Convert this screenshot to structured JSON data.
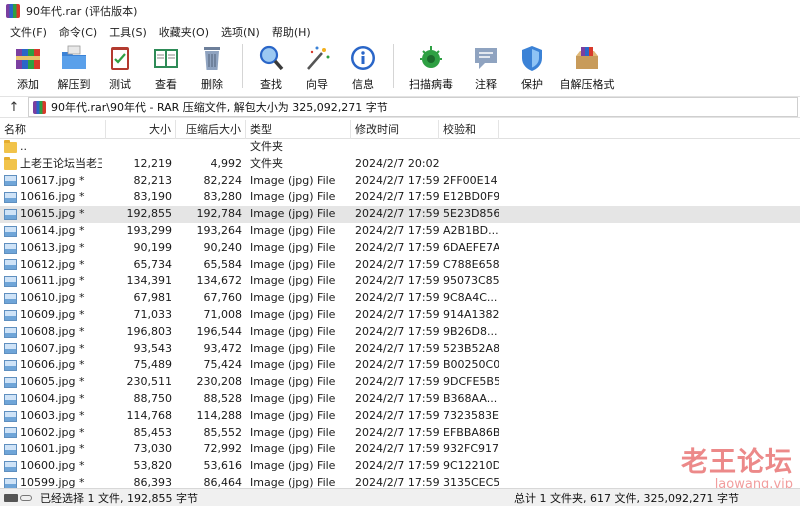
{
  "window": {
    "title": "90年代.rar (评估版本)"
  },
  "menu": [
    "文件(F)",
    "命令(C)",
    "工具(S)",
    "收藏夹(O)",
    "选项(N)",
    "帮助(H)"
  ],
  "toolbar": [
    {
      "label": "添加",
      "icon": "add-books-icon"
    },
    {
      "label": "解压到",
      "icon": "extract-folder-icon"
    },
    {
      "label": "测试",
      "icon": "test-clipboard-icon"
    },
    {
      "label": "查看",
      "icon": "view-book-icon"
    },
    {
      "label": "删除",
      "icon": "trash-icon"
    },
    {
      "label": "查找",
      "icon": "magnifier-icon"
    },
    {
      "label": "向导",
      "icon": "wizard-wand-icon"
    },
    {
      "label": "信息",
      "icon": "info-icon"
    },
    {
      "label": "扫描病毒",
      "icon": "virus-scan-icon"
    },
    {
      "label": "注释",
      "icon": "comment-icon"
    },
    {
      "label": "保护",
      "icon": "shield-icon"
    },
    {
      "label": "自解压格式",
      "icon": "sfx-box-icon"
    }
  ],
  "address": {
    "path": "90年代.rar\\90年代 - RAR 压缩文件, 解包大小为 325,092,271 字节"
  },
  "columns": {
    "name": "名称",
    "size": "大小",
    "packed": "压缩后大小",
    "type": "类型",
    "modified": "修改时间",
    "crc": "校验和"
  },
  "files": [
    {
      "name": "..",
      "size": "",
      "packed": "",
      "type": "文件夹",
      "modified": "",
      "crc": "",
      "kind": "folder"
    },
    {
      "name": "上老王论坛当老王",
      "size": "12,219",
      "packed": "4,992",
      "type": "文件夹",
      "modified": "2024/2/7 20:02",
      "crc": "",
      "kind": "folder"
    },
    {
      "name": "10617.jpg *",
      "size": "82,213",
      "packed": "82,224",
      "type": "Image (jpg) File",
      "modified": "2024/2/7 17:59",
      "crc": "2FF00E14",
      "kind": "image"
    },
    {
      "name": "10616.jpg *",
      "size": "83,190",
      "packed": "83,280",
      "type": "Image (jpg) File",
      "modified": "2024/2/7 17:59",
      "crc": "E12BD0F9",
      "kind": "image"
    },
    {
      "name": "10615.jpg *",
      "size": "192,855",
      "packed": "192,784",
      "type": "Image (jpg) File",
      "modified": "2024/2/7 17:59",
      "crc": "5E23D856",
      "kind": "image",
      "selected": true
    },
    {
      "name": "10614.jpg *",
      "size": "193,299",
      "packed": "193,264",
      "type": "Image (jpg) File",
      "modified": "2024/2/7 17:59",
      "crc": "A2B1BD...",
      "kind": "image"
    },
    {
      "name": "10613.jpg *",
      "size": "90,199",
      "packed": "90,240",
      "type": "Image (jpg) File",
      "modified": "2024/2/7 17:59",
      "crc": "6DAEFE7A",
      "kind": "image"
    },
    {
      "name": "10612.jpg *",
      "size": "65,734",
      "packed": "65,584",
      "type": "Image (jpg) File",
      "modified": "2024/2/7 17:59",
      "crc": "C788E658",
      "kind": "image"
    },
    {
      "name": "10611.jpg *",
      "size": "134,391",
      "packed": "134,672",
      "type": "Image (jpg) File",
      "modified": "2024/2/7 17:59",
      "crc": "95073C85",
      "kind": "image"
    },
    {
      "name": "10610.jpg *",
      "size": "67,981",
      "packed": "67,760",
      "type": "Image (jpg) File",
      "modified": "2024/2/7 17:59",
      "crc": "9C8A4C...",
      "kind": "image"
    },
    {
      "name": "10609.jpg *",
      "size": "71,033",
      "packed": "71,008",
      "type": "Image (jpg) File",
      "modified": "2024/2/7 17:59",
      "crc": "914A1382",
      "kind": "image"
    },
    {
      "name": "10608.jpg *",
      "size": "196,803",
      "packed": "196,544",
      "type": "Image (jpg) File",
      "modified": "2024/2/7 17:59",
      "crc": "9B26D8...",
      "kind": "image"
    },
    {
      "name": "10607.jpg *",
      "size": "93,543",
      "packed": "93,472",
      "type": "Image (jpg) File",
      "modified": "2024/2/7 17:59",
      "crc": "523B52A8",
      "kind": "image"
    },
    {
      "name": "10606.jpg *",
      "size": "75,489",
      "packed": "75,424",
      "type": "Image (jpg) File",
      "modified": "2024/2/7 17:59",
      "crc": "B00250C0",
      "kind": "image"
    },
    {
      "name": "10605.jpg *",
      "size": "230,511",
      "packed": "230,208",
      "type": "Image (jpg) File",
      "modified": "2024/2/7 17:59",
      "crc": "9DCFE5B5",
      "kind": "image"
    },
    {
      "name": "10604.jpg *",
      "size": "88,750",
      "packed": "88,528",
      "type": "Image (jpg) File",
      "modified": "2024/2/7 17:59",
      "crc": "B368AA...",
      "kind": "image"
    },
    {
      "name": "10603.jpg *",
      "size": "114,768",
      "packed": "114,288",
      "type": "Image (jpg) File",
      "modified": "2024/2/7 17:59",
      "crc": "7323583E",
      "kind": "image"
    },
    {
      "name": "10602.jpg *",
      "size": "85,453",
      "packed": "85,552",
      "type": "Image (jpg) File",
      "modified": "2024/2/7 17:59",
      "crc": "EFBBA86B",
      "kind": "image"
    },
    {
      "name": "10601.jpg *",
      "size": "73,030",
      "packed": "72,992",
      "type": "Image (jpg) File",
      "modified": "2024/2/7 17:59",
      "crc": "932FC917",
      "kind": "image"
    },
    {
      "name": "10600.jpg *",
      "size": "53,820",
      "packed": "53,616",
      "type": "Image (jpg) File",
      "modified": "2024/2/7 17:59",
      "crc": "9C12210D",
      "kind": "image"
    },
    {
      "name": "10599.jpg *",
      "size": "86,393",
      "packed": "86,464",
      "type": "Image (jpg) File",
      "modified": "2024/2/7 17:59",
      "crc": "3135CEC5",
      "kind": "image"
    }
  ],
  "status": {
    "left": "已经选择 1 文件, 192,855 字节",
    "right": "总计 1 文件夹, 617 文件, 325,092,271 字节"
  },
  "watermark": {
    "cn": "老王论坛",
    "en": "laowang.vip"
  }
}
